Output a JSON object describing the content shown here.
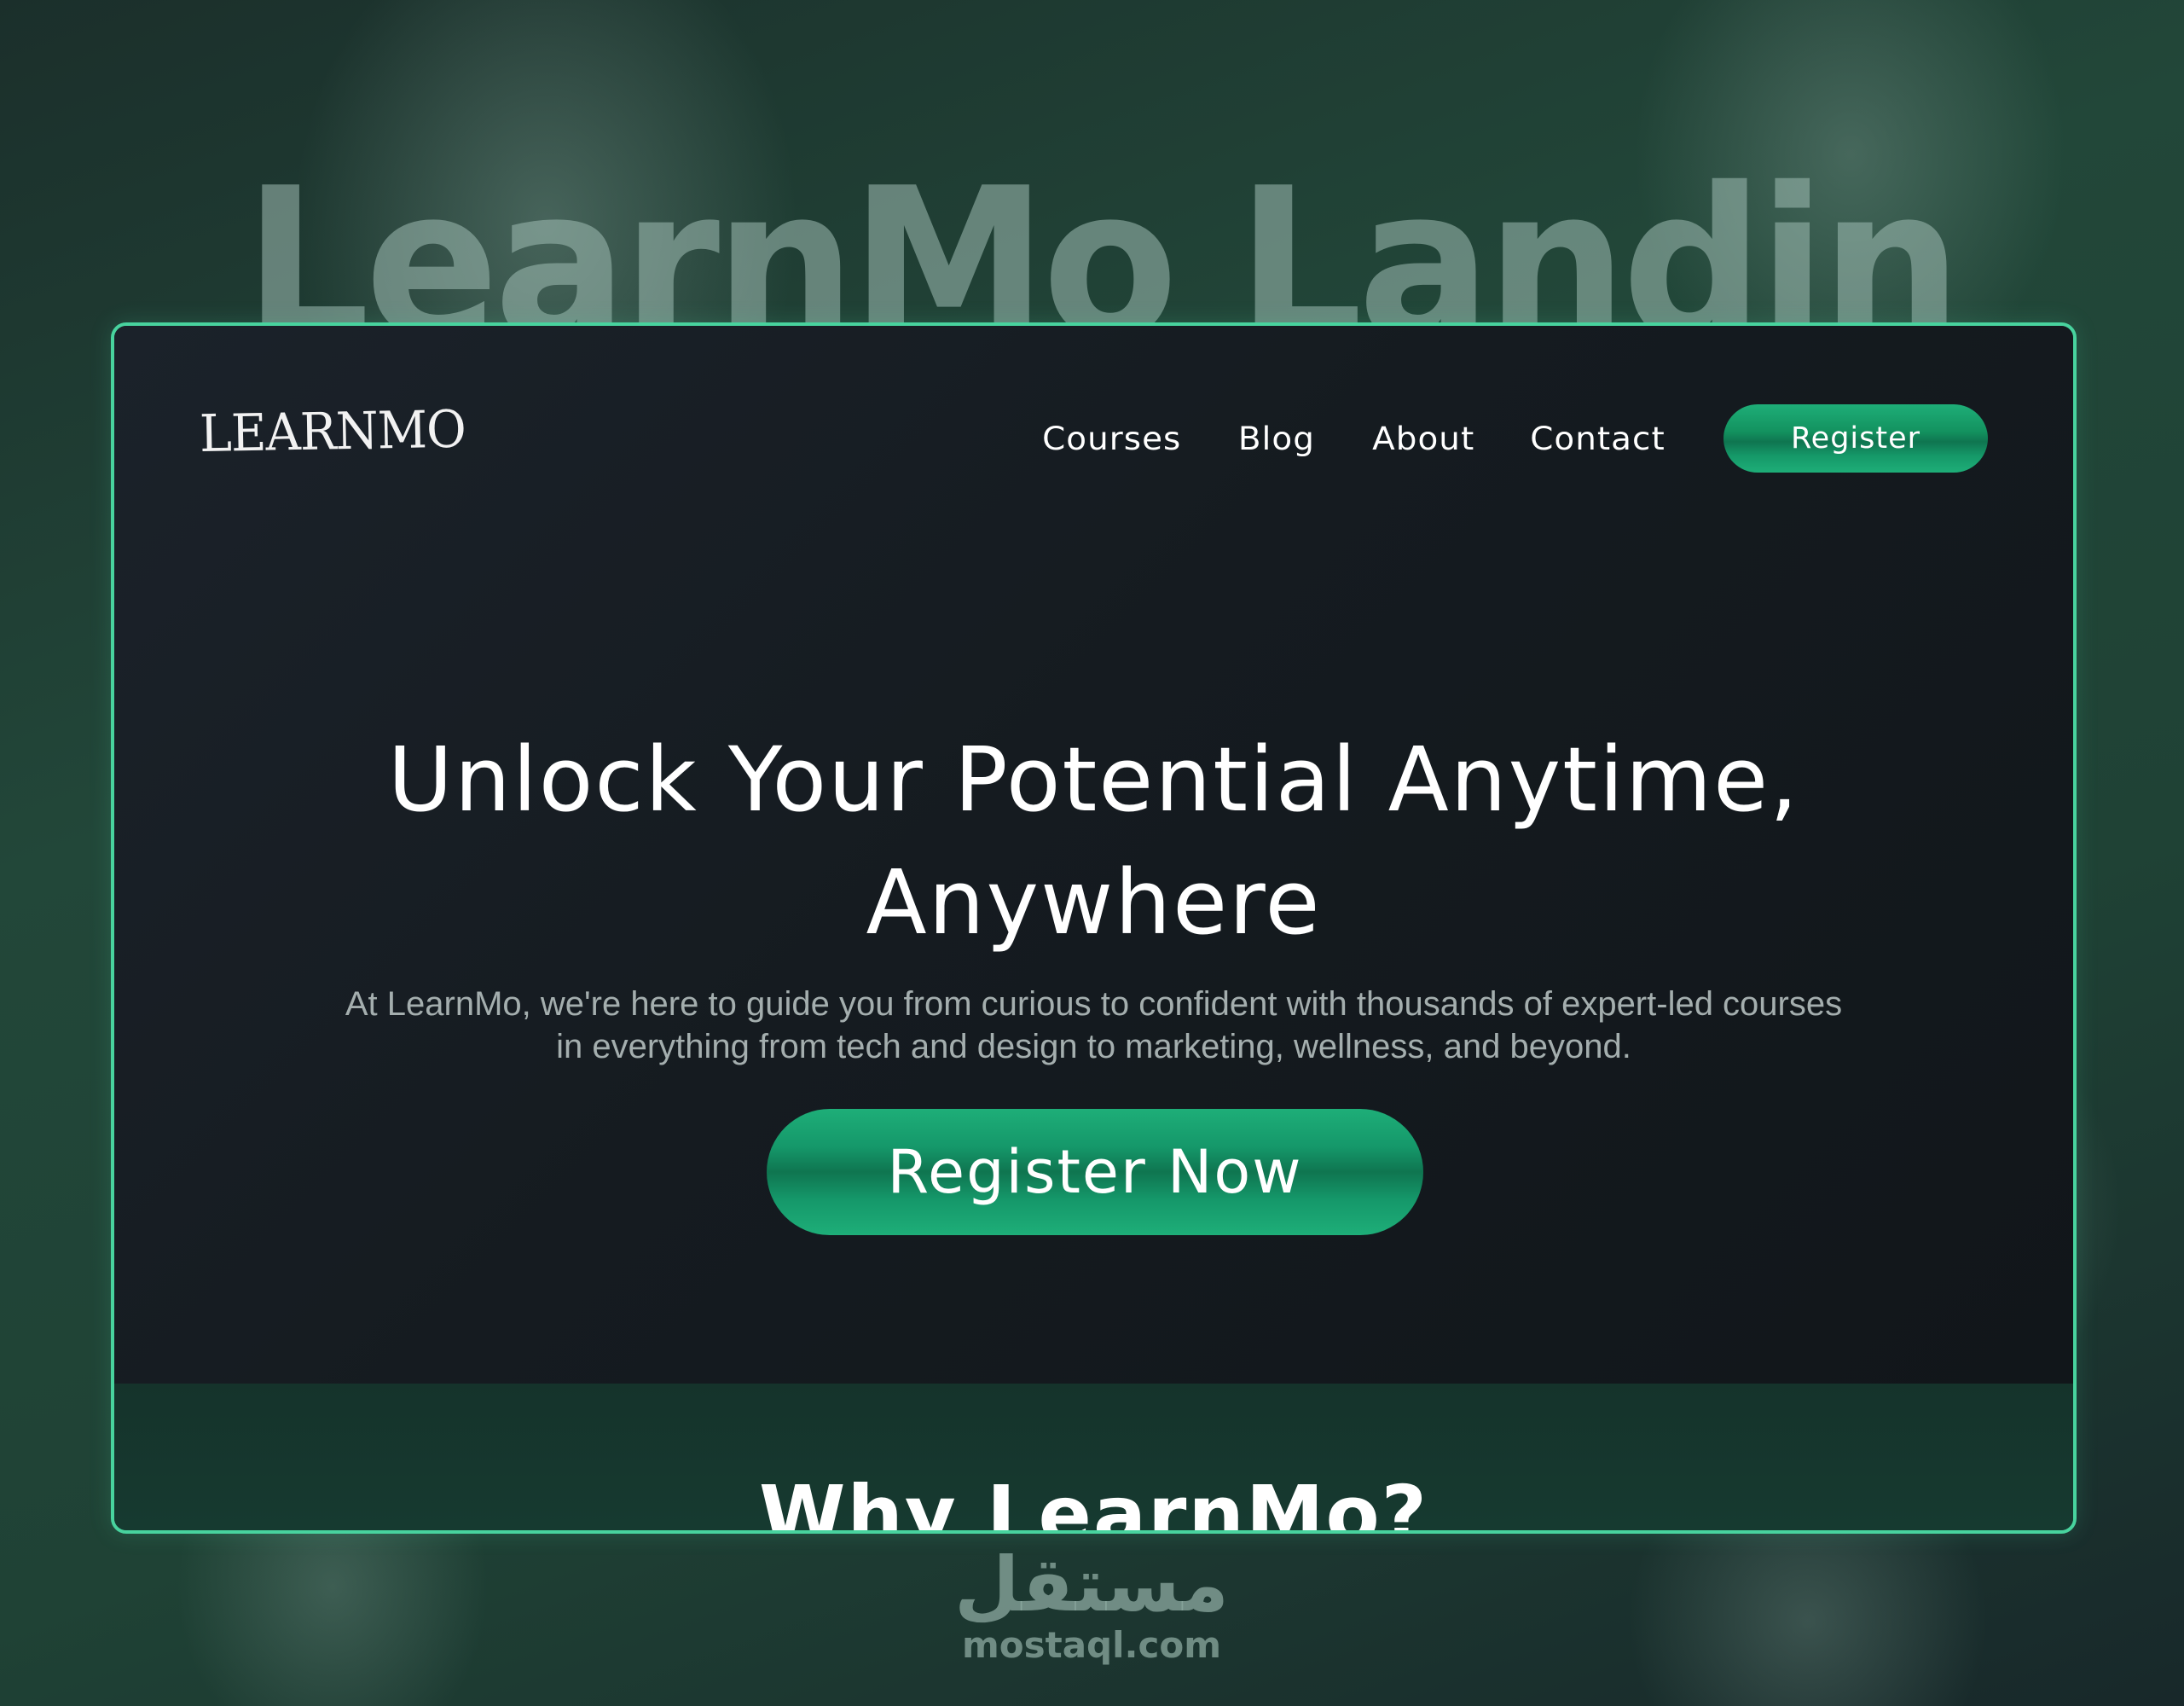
{
  "showcase": {
    "title": "LearnMo Landing"
  },
  "colors": {
    "accent": "#48d39e",
    "button_green": "#1eae78",
    "hero_bg": "#151b20",
    "section_bg": "#15332b",
    "page_bg": "#1f4235"
  },
  "header": {
    "logo_text": "LEARNMO",
    "nav": [
      {
        "label": "Courses"
      },
      {
        "label": "Blog"
      },
      {
        "label": "About"
      },
      {
        "label": "Contact"
      }
    ],
    "register_label": "Register"
  },
  "hero": {
    "headline_line1": "Unlock Your Potential Anytime,",
    "headline_line2": "Anywhere",
    "subtext_line1": "At LearnMo, we're here to guide you from curious to confident with thousands of expert-led courses",
    "subtext_line2": "in everything from tech and design to marketing, wellness, and beyond.",
    "cta_label": "Register Now"
  },
  "why_section": {
    "title": "Why LearnMo?"
  },
  "watermark": {
    "arabic": "مستقل",
    "latin": "mostaql.com"
  }
}
